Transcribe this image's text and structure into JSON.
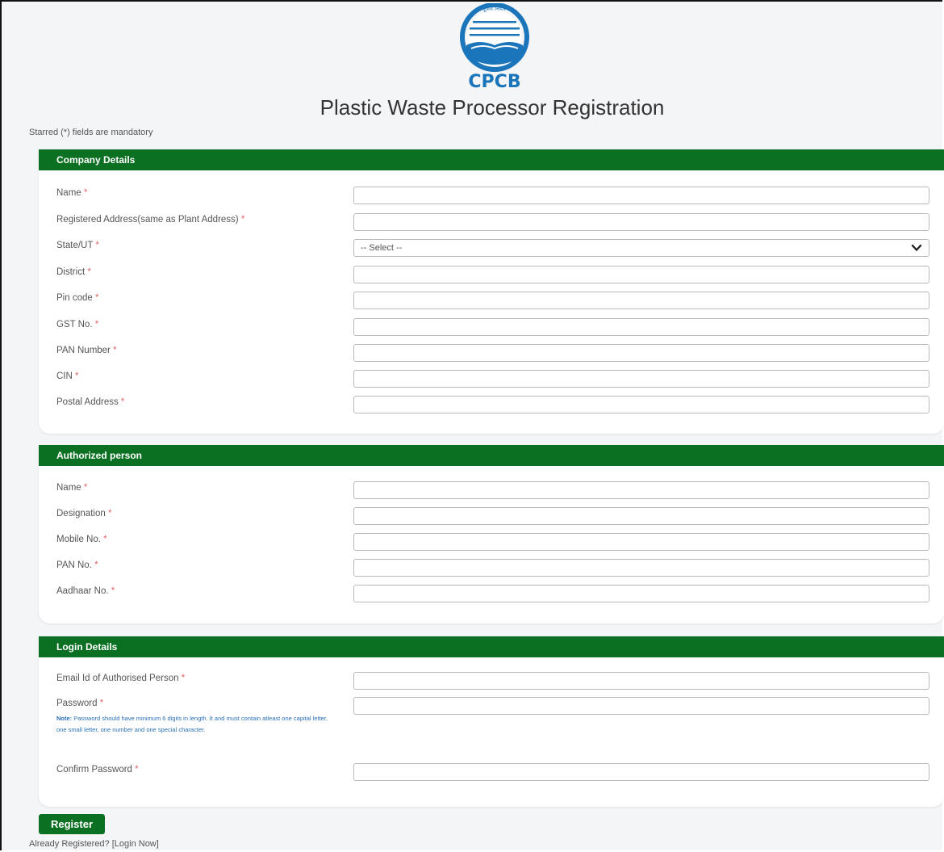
{
  "header": {
    "logo_text": "CPCB",
    "logo_top_text": "प्रदूषण नियंत्रण",
    "logo_ring_text": "MINISTRY OF CLEAN ENVIRONMENT",
    "title": "Plastic Waste Processor Registration"
  },
  "mandatory_note": "Starred (*) fields are mandatory",
  "company": {
    "heading": "Company Details",
    "fields": [
      {
        "label": "Name",
        "star": "*",
        "value": ""
      },
      {
        "label": "Registered Address(same as Plant Address)",
        "star": "*",
        "value": ""
      },
      {
        "label": "State/UT",
        "star": "*",
        "value": "-- Select --"
      },
      {
        "label": "District",
        "star": "*",
        "value": ""
      },
      {
        "label": "Pin code",
        "star": "*",
        "value": ""
      },
      {
        "label": "GST No.",
        "star": "*",
        "value": ""
      },
      {
        "label": "PAN Number",
        "star": "*",
        "value": ""
      },
      {
        "label": "CIN",
        "star": "*",
        "value": ""
      },
      {
        "label": "Postal Address",
        "star": "*",
        "value": ""
      }
    ]
  },
  "authorized": {
    "heading": "Authorized person",
    "fields": [
      {
        "label": "Name",
        "star": "*",
        "value": ""
      },
      {
        "label": "Designation",
        "star": "*",
        "value": ""
      },
      {
        "label": "Mobile No.",
        "star": "*",
        "value": ""
      },
      {
        "label": "PAN No.",
        "star": "*",
        "value": ""
      },
      {
        "label": "Aadhaar No.",
        "star": "*",
        "value": ""
      }
    ]
  },
  "login": {
    "heading": "Login Details",
    "fields": [
      {
        "label": "Email Id of Authorised Person",
        "star": "*",
        "value": ""
      },
      {
        "label": "Password",
        "star": "*",
        "value": ""
      },
      {
        "label": "Confirm Password",
        "star": "*",
        "value": ""
      }
    ],
    "note_bold": "Note:",
    "note_text": " Password should have minimum 6 digits in length. It and must contain atleast one capital letter, one small letter, one number and one special character."
  },
  "register_label": "Register",
  "login_prompt": "Already Registered? [Login Now]",
  "colors": {
    "brand_green": "#0c7023",
    "logo_blue": "#1a75bb",
    "required_star": "#e06666"
  }
}
